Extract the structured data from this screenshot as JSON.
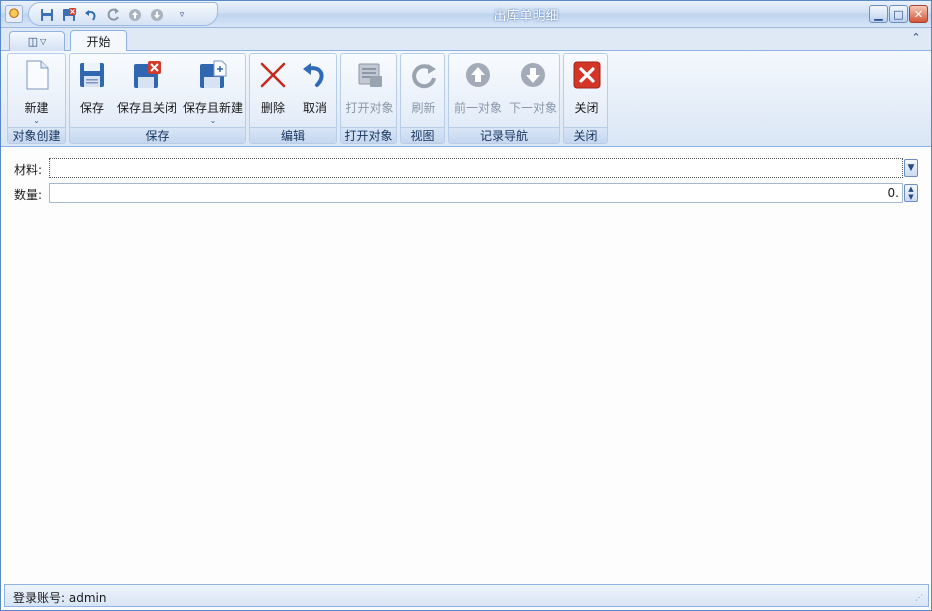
{
  "window": {
    "title": "出库单明细",
    "quick_access": [
      "save-icon",
      "save-close-icon",
      "undo-icon",
      "redo-icon",
      "up-icon",
      "down-icon",
      "customize-icon"
    ],
    "controls": [
      "minimize",
      "maximize",
      "close"
    ]
  },
  "tabs": {
    "app_menu_icon": "panel-icon",
    "active": "开始"
  },
  "ribbon": {
    "groups": {
      "create": "对象创建",
      "save": "保存",
      "edit": "编辑",
      "open": "打开对象",
      "view": "视图",
      "nav": "记录导航",
      "close": "关闭"
    },
    "buttons": {
      "new": "新建",
      "save": "保存",
      "save_close": "保存且关闭",
      "save_new": "保存且新建",
      "delete": "删除",
      "cancel": "取消",
      "open_object": "打开对象",
      "refresh": "刷新",
      "prev": "前一对象",
      "next": "下一对象",
      "close": "关闭"
    }
  },
  "form": {
    "material_label": "材料:",
    "material_value": "",
    "quantity_label": "数量:",
    "quantity_value": "0."
  },
  "status": {
    "login_text": "登录账号: admin"
  },
  "colors": {
    "accent": "#8db2e3",
    "title_text": "#ffffff",
    "close_red": "#d4553a"
  }
}
